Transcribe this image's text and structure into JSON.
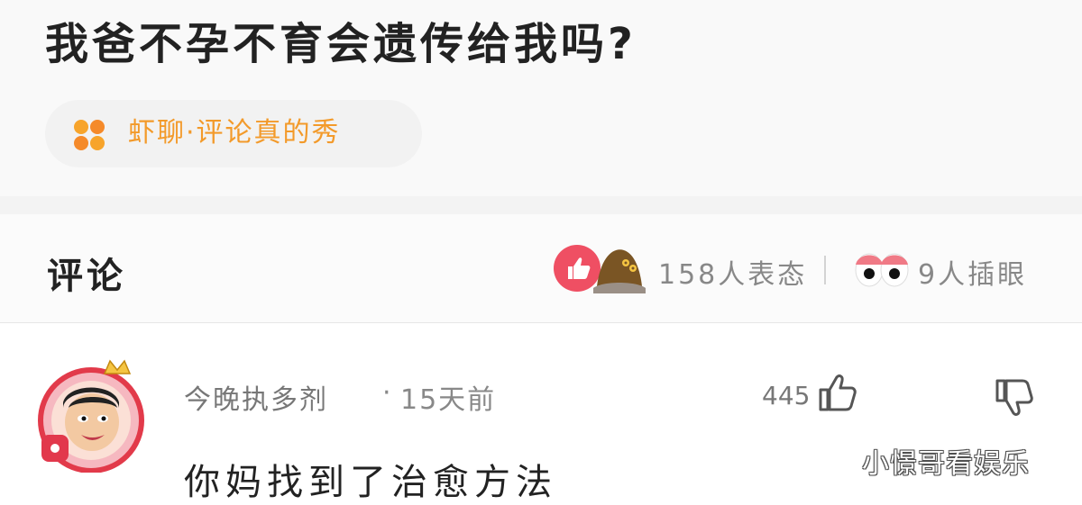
{
  "question": {
    "title": "我爸不孕不育会遗传给我吗?"
  },
  "source": {
    "label": "虾聊·评论真的秀",
    "icon": "orange-clover-icon",
    "color": "#f39a2a"
  },
  "comments_header": {
    "title": "评论",
    "reactions_text": "158人表态",
    "eyes_text": "9人插眼",
    "like_badge_color": "#ef4f63"
  },
  "comment": {
    "author": "今晚执多剂",
    "dot": "·",
    "time": "15天前",
    "likes": "445",
    "text": "你妈找到了治愈方法"
  },
  "watermark": "小憬哥看娱乐"
}
